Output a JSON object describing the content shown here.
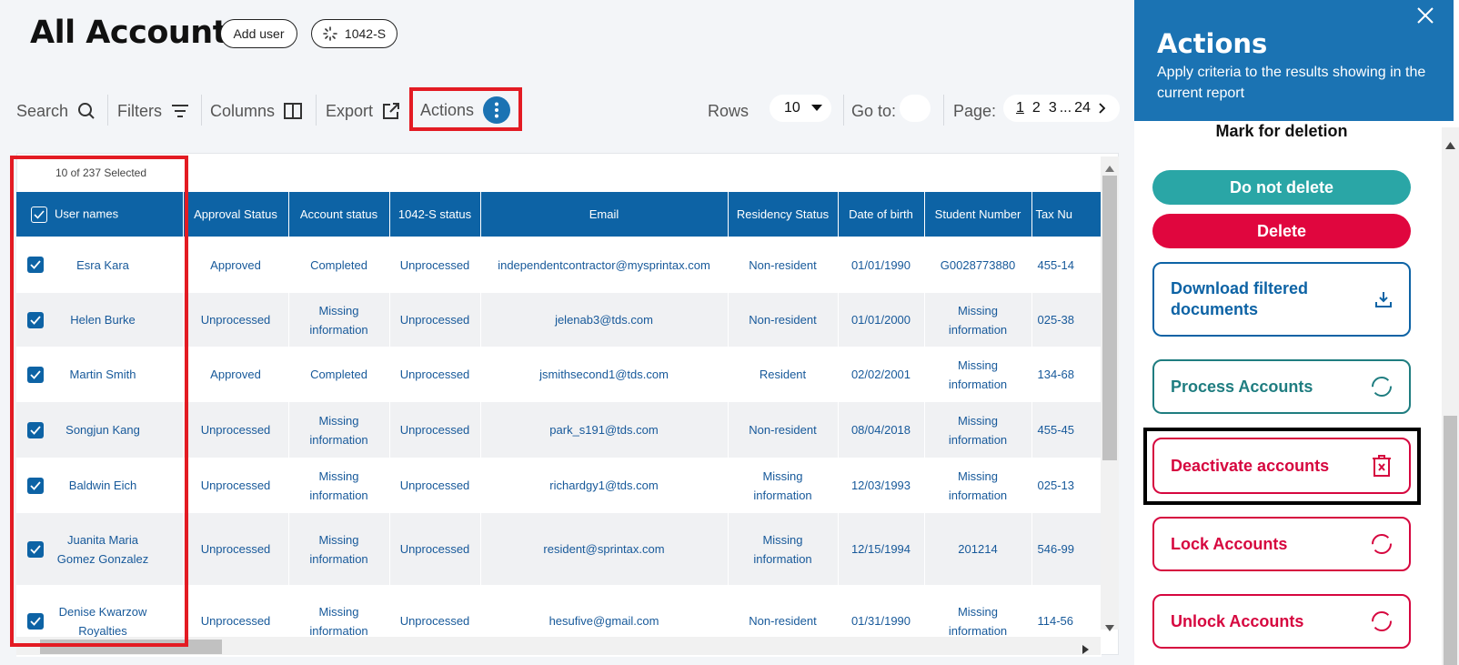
{
  "header": {
    "title": "All Accounts",
    "add_user": "Add user",
    "form_filter": "1042-S"
  },
  "toolbar": {
    "search": "Search",
    "filters": "Filters",
    "columns": "Columns",
    "export": "Export",
    "actions": "Actions",
    "rows_label": "Rows",
    "rows_value": "10",
    "goto_label": "Go to:",
    "page_label": "Page:",
    "pages": [
      "1",
      "2",
      "3",
      "...",
      "24"
    ]
  },
  "table": {
    "selected_text": "10 of 237 Selected",
    "columns": [
      "User names",
      "Approval Status",
      "Account status",
      "1042-S status",
      "Email",
      "Residency Status",
      "Date of birth",
      "Student Number",
      "Tax Nu"
    ],
    "rows": [
      {
        "name": "Esra Kara",
        "approval": "Approved",
        "account": "Completed",
        "s1042": "Unprocessed",
        "email": "independentcontractor@mysprintax.com",
        "residency": "Non-resident",
        "dob": "01/01/1990",
        "student": "G0028773880",
        "tax": "455-14"
      },
      {
        "name": "Helen Burke",
        "approval": "Unprocessed",
        "account": "Missing information",
        "s1042": "Unprocessed",
        "email": "jelenab3@tds.com",
        "residency": "Non-resident",
        "dob": "01/01/2000",
        "student": "Missing information",
        "tax": "025-38"
      },
      {
        "name": "Martin Smith",
        "approval": "Approved",
        "account": "Completed",
        "s1042": "Unprocessed",
        "email": "jsmithsecond1@tds.com",
        "residency": "Resident",
        "dob": "02/02/2001",
        "student": "Missing information",
        "tax": "134-68"
      },
      {
        "name": "Songjun Kang",
        "approval": "Unprocessed",
        "account": "Missing information",
        "s1042": "Unprocessed",
        "email": "park_s191@tds.com",
        "residency": "Non-resident",
        "dob": "08/04/2018",
        "student": "Missing information",
        "tax": "455-45"
      },
      {
        "name": "Baldwin Eich",
        "approval": "Unprocessed",
        "account": "Missing information",
        "s1042": "Unprocessed",
        "email": "richardgy1@tds.com",
        "residency": "Missing information",
        "dob": "12/03/1993",
        "student": "Missing information",
        "tax": "025-13"
      },
      {
        "name": "Juanita Maria Gomez Gonzalez",
        "approval": "Unprocessed",
        "account": "Missing information",
        "s1042": "Unprocessed",
        "email": "resident@sprintax.com",
        "residency": "Missing information",
        "dob": "12/15/1994",
        "student": "201214",
        "tax": "546-99"
      },
      {
        "name": "Denise Kwarzow Royalties",
        "approval": "Unprocessed",
        "account": "Missing information",
        "s1042": "Unprocessed",
        "email": "hesufive@gmail.com",
        "residency": "Non-resident",
        "dob": "01/31/1990",
        "student": "Missing information",
        "tax": "114-56"
      }
    ]
  },
  "panel": {
    "title": "Actions",
    "subtitle": "Apply criteria to the results showing in the current report",
    "mark_label": "Mark for deletion",
    "do_not_delete": "Do not delete",
    "delete": "Delete",
    "download": "Download filtered documents",
    "process": "Process Accounts",
    "deactivate": "Deactivate accounts",
    "lock": "Lock Accounts",
    "unlock": "Unlock Accounts"
  },
  "colors": {
    "primary": "#0d63a5",
    "teal": "#2aa6a6",
    "danger": "#e0063e",
    "highlight_red": "#e31b23"
  }
}
